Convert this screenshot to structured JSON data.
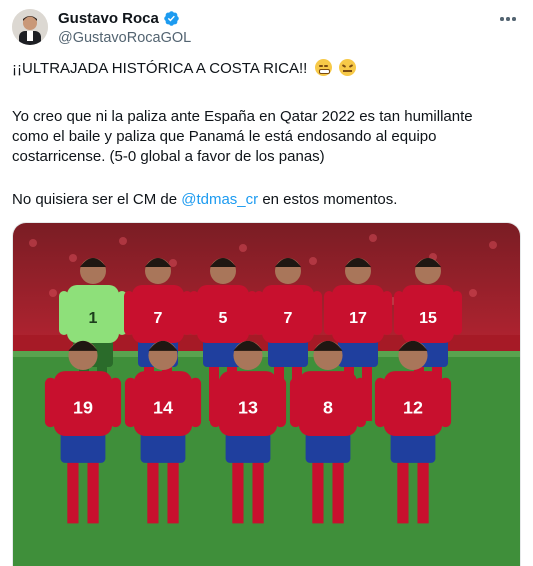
{
  "author": {
    "name": "Gustavo Roca",
    "handle": "@GustavoRocaGOL",
    "verified": true
  },
  "icons": {
    "verified": "verified-badge-icon",
    "more": "more-options-icon",
    "emojis": [
      "grimacing-face-emoji",
      "confounded-face-emoji"
    ]
  },
  "tweet": {
    "line1": "¡¡ULTRAJADA HISTÓRICA A COSTA RICA!!",
    "paragraph2_line1": "Yo creo que ni la paliza ante España en Qatar 2022 es tan humillante",
    "paragraph2_line2": "como el baile y paliza que Panamá le está endosando al equipo",
    "paragraph2_line3": "costarricense. (5-0 global a favor de los panas)",
    "line4_before": "No quisiera ser el CM de ",
    "line4_mention": "@tdmas_cr",
    "line4_after": " en estos momentos."
  },
  "media": {
    "description_kind": "team-photo",
    "jersey_numbers_front": [
      "19",
      "14",
      "13",
      "8",
      "12"
    ],
    "jersey_numbers_back": [
      "1",
      "7",
      "5",
      "7",
      "17",
      "15"
    ]
  },
  "colors": {
    "accent": "#1d9bf0",
    "text": "#0f1419",
    "secondary": "#536471",
    "kit_red": "#c8102e",
    "kit_blue": "#1f3f9e",
    "goalkeeper": "#8ee07a",
    "pitch": "#3f8f3a"
  }
}
